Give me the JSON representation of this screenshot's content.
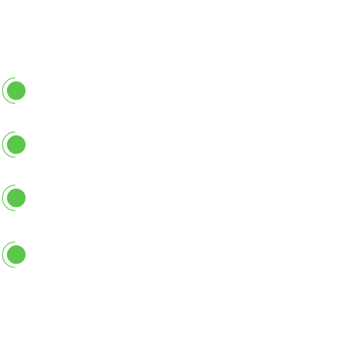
{
  "colors": {
    "background": "#ffffff",
    "accent": "#5cc64a"
  },
  "indicators": [
    {
      "icon": "green-dot-icon",
      "state": "active"
    },
    {
      "icon": "green-dot-icon",
      "state": "active"
    },
    {
      "icon": "green-dot-icon",
      "state": "active"
    },
    {
      "icon": "green-dot-icon",
      "state": "active"
    }
  ]
}
